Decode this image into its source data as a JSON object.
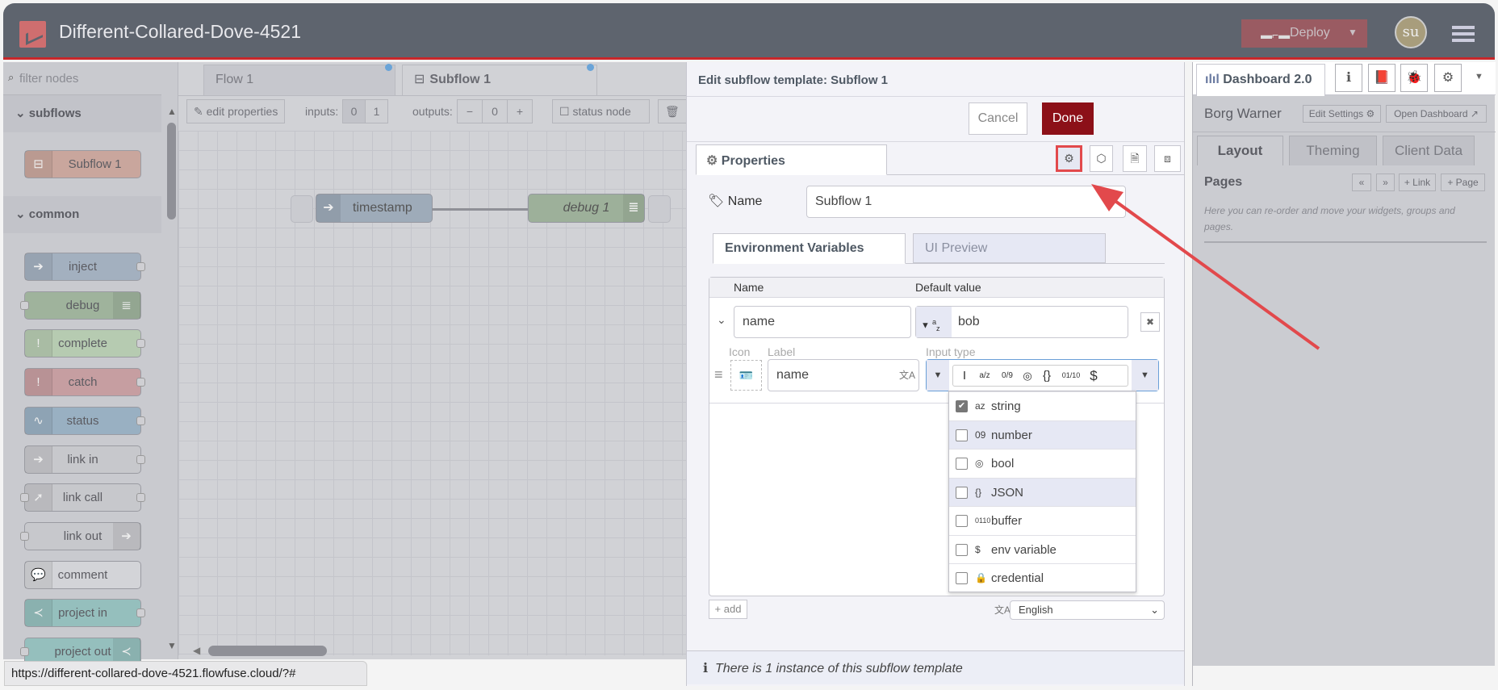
{
  "header": {
    "title": "Different-Collared-Dove-4521",
    "deploy": "Deploy",
    "avatar": "su"
  },
  "palette": {
    "filter_placeholder": "filter nodes",
    "categories": [
      "subflows",
      "common"
    ],
    "subflow_nodes": [
      "Subflow 1"
    ],
    "nodes": [
      "inject",
      "debug",
      "complete",
      "catch",
      "status",
      "link in",
      "link call",
      "link out",
      "comment",
      "project in",
      "project out"
    ]
  },
  "workspace": {
    "tabs": [
      "Flow 1",
      "Subflow 1"
    ],
    "toolbar": {
      "edit_properties": "edit properties",
      "inputs_label": "inputs:",
      "inputs_options": [
        "0",
        "1"
      ],
      "outputs_label": "outputs:",
      "outputs_value": "0",
      "status_node": "status node"
    },
    "nodes": [
      "timestamp",
      "debug 1"
    ]
  },
  "editor": {
    "title": "Edit subflow template: Subflow 1",
    "cancel": "Cancel",
    "done": "Done",
    "properties_tab": "Properties",
    "name_label": "Name",
    "name_value": "Subflow 1",
    "tabs": [
      "Environment Variables",
      "UI Preview"
    ],
    "table_headers": [
      "Name",
      "Default value"
    ],
    "env": {
      "name": "name",
      "value": "bob",
      "icon_label": "Icon",
      "label_label": "Label",
      "label_value": "name",
      "input_type_label": "Input type"
    },
    "type_icons": [
      "I",
      "a/z",
      "0/9",
      "◎",
      "{}",
      "01/10",
      "$"
    ],
    "dropdown": [
      {
        "label": "string",
        "icon": "az",
        "checked": true
      },
      {
        "label": "number",
        "icon": "09",
        "checked": false
      },
      {
        "label": "bool",
        "icon": "◎",
        "checked": false
      },
      {
        "label": "JSON",
        "icon": "{}",
        "checked": false
      },
      {
        "label": "buffer",
        "icon": "0110",
        "checked": false
      },
      {
        "label": "env variable",
        "icon": "$",
        "checked": false
      },
      {
        "label": "credential",
        "icon": "lock",
        "checked": false
      }
    ],
    "add": "add",
    "language": "English",
    "footer": "There is 1 instance of this subflow template"
  },
  "sidebar": {
    "tab": "Dashboard 2.0",
    "dashboard_name": "Borg Warner",
    "edit_settings": "Edit Settings",
    "open_dashboard": "Open Dashboard",
    "tabs": [
      "Layout",
      "Theming",
      "Client Data"
    ],
    "pages_title": "Pages",
    "link_btn": "Link",
    "page_btn": "Page",
    "help": "Here you can re-order and move your widgets, groups and pages."
  },
  "status_url": "https://different-collared-dove-4521.flowfuse.cloud/?#",
  "colors": {
    "accent": "#e2494c",
    "done": "#8c1018",
    "header": "#5e646e"
  }
}
